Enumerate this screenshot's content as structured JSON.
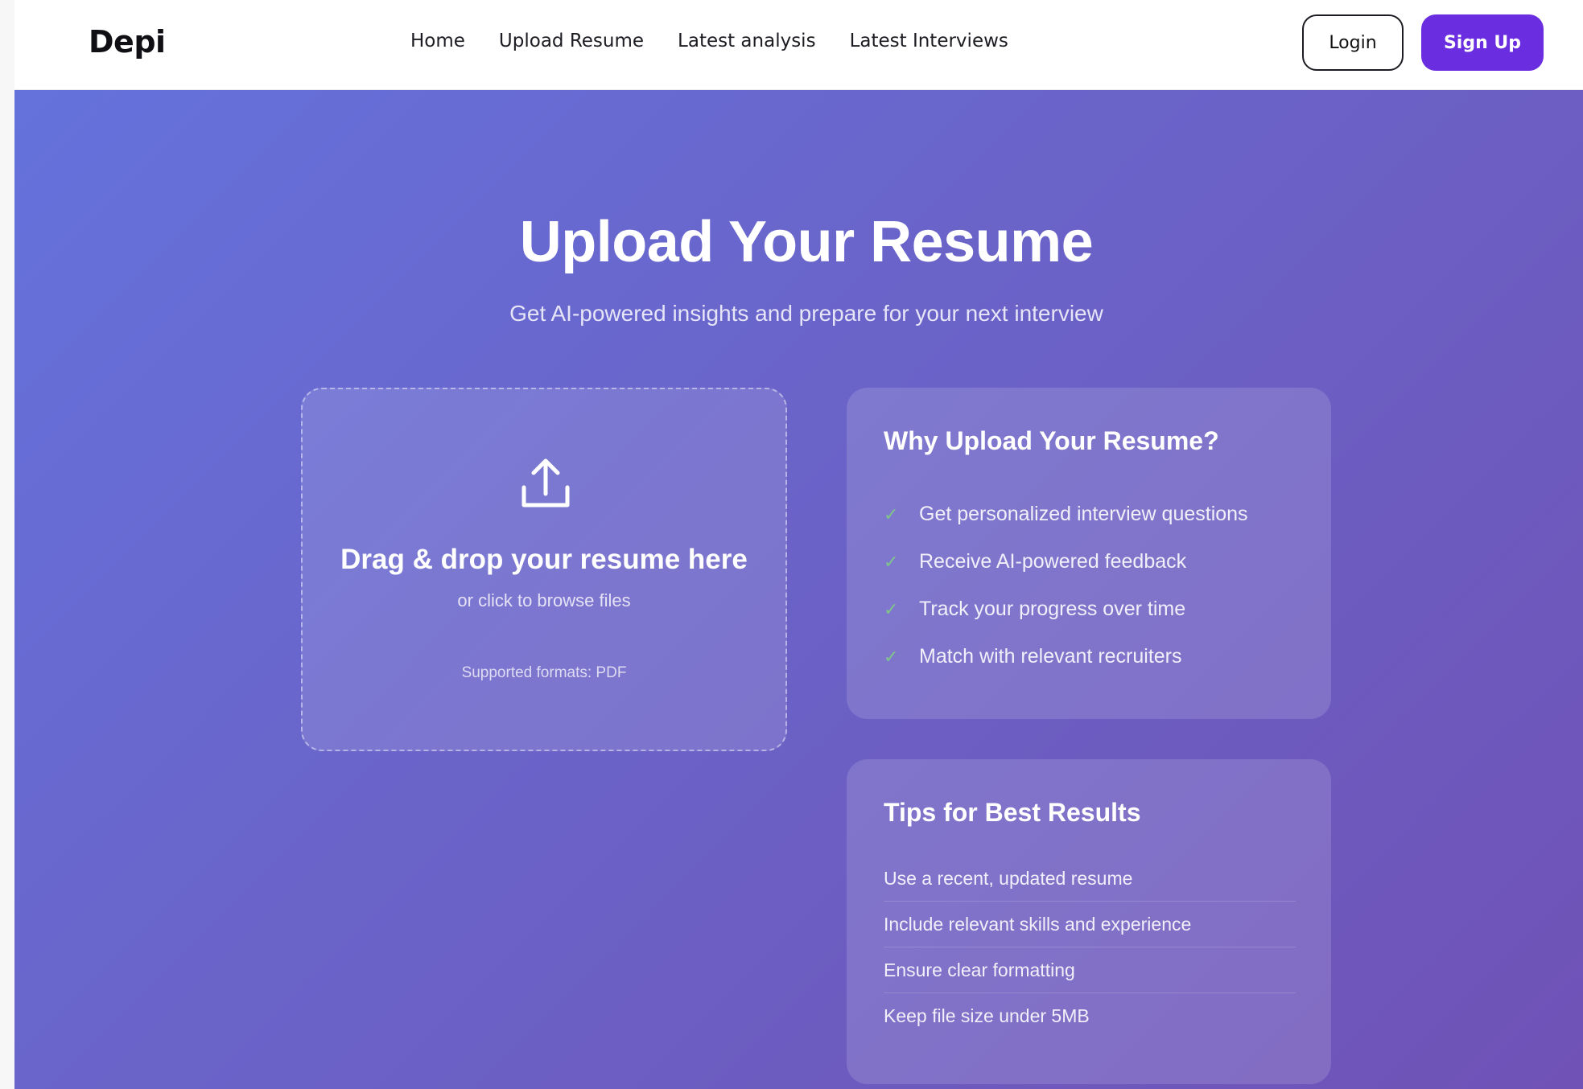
{
  "header": {
    "logo": "Depi",
    "nav": [
      {
        "label": "Home"
      },
      {
        "label": "Upload Resume"
      },
      {
        "label": "Latest analysis"
      },
      {
        "label": "Latest Interviews"
      }
    ],
    "login_label": "Login",
    "signup_label": "Sign Up"
  },
  "hero": {
    "title": "Upload Your Resume",
    "subtitle": "Get AI-powered insights and prepare for your next interview"
  },
  "dropzone": {
    "icon": "upload-icon",
    "title": "Drag & drop your resume here",
    "subtitle": "or click to browse files",
    "formats": "Supported formats: PDF"
  },
  "why": {
    "title": "Why Upload Your Resume?",
    "items": [
      {
        "label": "Get personalized interview questions"
      },
      {
        "label": "Receive AI-powered feedback"
      },
      {
        "label": "Track your progress over time"
      },
      {
        "label": "Match with relevant recruiters"
      }
    ]
  },
  "tips": {
    "title": "Tips for Best Results",
    "items": [
      {
        "label": "Use a recent, updated resume"
      },
      {
        "label": "Include relevant skills and experience"
      },
      {
        "label": "Ensure clear formatting"
      },
      {
        "label": "Keep file size under 5MB"
      }
    ]
  },
  "colors": {
    "brand": "#6a2ee0",
    "check": "#7fc48a",
    "hero_gradient_start": "#6572dc",
    "hero_gradient_end": "#7052b6"
  }
}
